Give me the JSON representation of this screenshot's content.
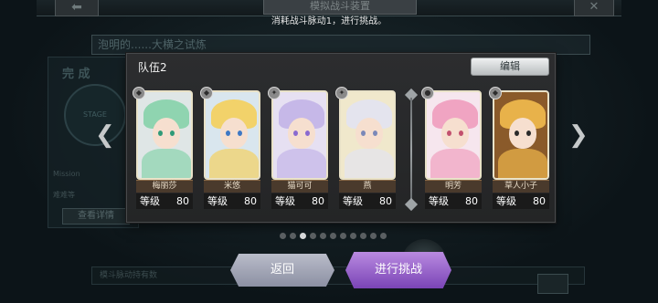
{
  "background": {
    "back_glyph": "⬅",
    "close_glyph": "✕",
    "title": "模拟战斗装置",
    "subtitle": "消耗战斗脉动1，进行挑战。",
    "stage_bar_text": "泡明的......大横之试炼",
    "complete_label": "完 成",
    "stage_label": "STAGE",
    "mission_label": "Mission",
    "mission_sub": "难难等",
    "view_detail_label": "查看详情",
    "bottom_bar_text": "模斗脉动持有数"
  },
  "modal": {
    "title": "队伍2",
    "edit_label": "编辑",
    "level_label": "等级",
    "heroes": [
      {
        "name": "梅丽莎",
        "level": "80",
        "role_icon": "shield-icon",
        "hair": "#8fd4b0",
        "bg": "#dfe6e6",
        "eye": "#2f9a78"
      },
      {
        "name": "米悠",
        "level": "80",
        "role_icon": "shield-icon",
        "hair": "#f2d26a",
        "bg": "#d9e6ee",
        "eye": "#3e78c4"
      },
      {
        "name": "猫可可",
        "level": "80",
        "role_icon": "staff-icon",
        "hair": "#c6b8e8",
        "bg": "#e6e0f2",
        "eye": "#8a6ad0"
      },
      {
        "name": "燕",
        "level": "80",
        "role_icon": "staff-icon",
        "hair": "#e4e4ee",
        "bg": "#f0e8cc",
        "eye": "#7a88b8"
      },
      {
        "name": "明芳",
        "level": "80",
        "role_icon": "fist-icon",
        "hair": "#f0a4c2",
        "bg": "#f6e6ee",
        "eye": "#c2506e"
      },
      {
        "name": "草人小子",
        "level": "80",
        "role_icon": "shield-icon",
        "hair": "#e8b24a",
        "bg": "#8a5a2a",
        "eye": "#2a2a2a"
      }
    ]
  },
  "pagination": {
    "count": 11,
    "active_index": 2
  },
  "buttons": {
    "back_label": "返回",
    "challenge_label": "进行挑战"
  },
  "nav": {
    "prev_glyph": "❮",
    "next_glyph": "❯"
  }
}
